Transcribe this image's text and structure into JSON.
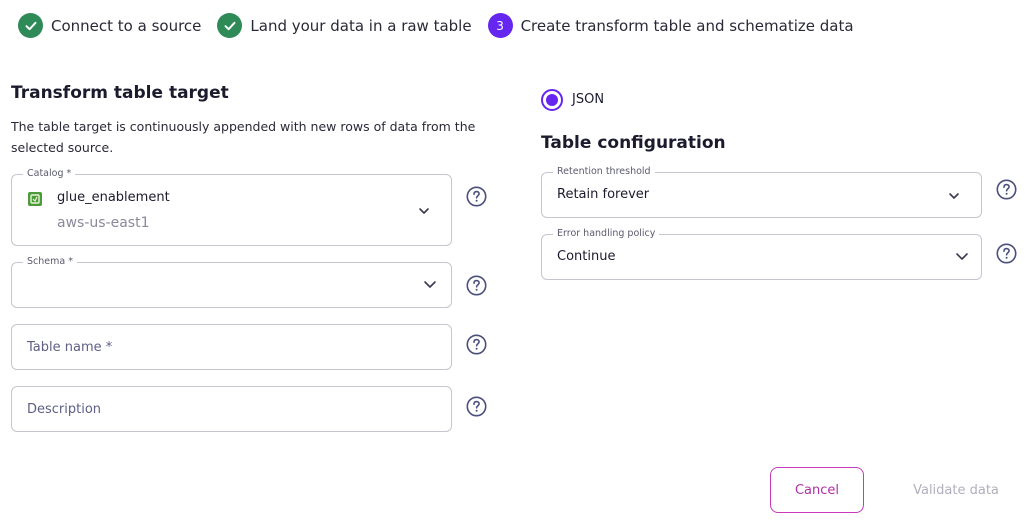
{
  "stepper": {
    "steps": [
      {
        "label": "Connect to a source",
        "state": "done"
      },
      {
        "label": "Land your data in a raw table",
        "state": "done"
      },
      {
        "label": "Create transform table and schematize data",
        "state": "active",
        "number": "3"
      }
    ]
  },
  "left": {
    "title": "Transform table target",
    "description": "The table target is continuously appended with new rows of data from the selected source.",
    "catalog": {
      "legend": "Catalog *",
      "value": "glue_enablement",
      "sub": "aws-us-east1"
    },
    "schema": {
      "legend": "Schema *",
      "value": ""
    },
    "table_name": {
      "placeholder": "Table name *"
    },
    "description_field": {
      "placeholder": "Description"
    }
  },
  "right": {
    "format": {
      "label": "JSON",
      "selected": true
    },
    "title": "Table configuration",
    "retention": {
      "legend": "Retention threshold",
      "value": "Retain forever"
    },
    "error_policy": {
      "legend": "Error handling policy",
      "value": "Continue"
    }
  },
  "actions": {
    "cancel": "Cancel",
    "validate": "Validate data"
  },
  "colors": {
    "step_done": "#2e8a57",
    "step_active": "#6526f0",
    "accent": "#6526f0",
    "cancel": "#c43ab8",
    "disabled_text": "#b0afbd"
  },
  "icons": {
    "step_done": "check-icon",
    "help": "help-circle-icon",
    "dropdown": "chevron-down-icon",
    "catalog": "aws-glue-icon"
  }
}
